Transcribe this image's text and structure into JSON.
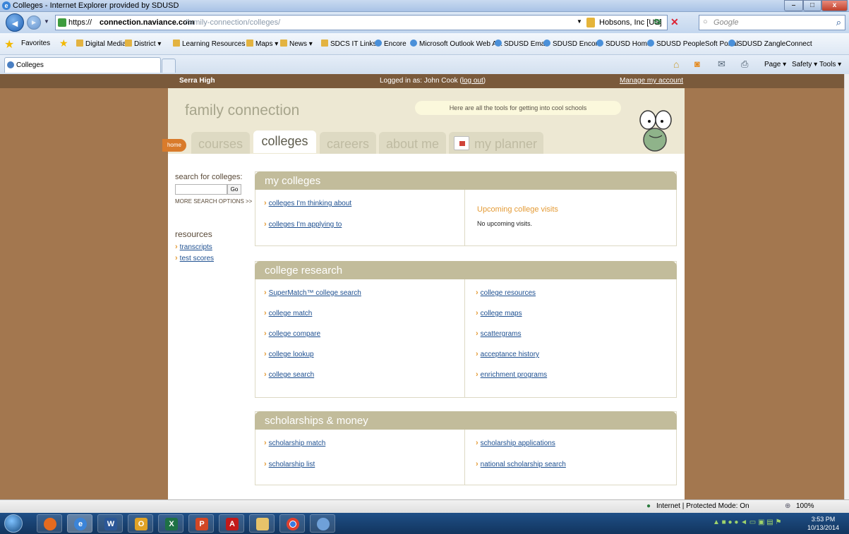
{
  "window": {
    "title": "Colleges - Internet Explorer provided by SDUSD",
    "minimize": "–",
    "maximize": "□",
    "close": "x"
  },
  "address": {
    "url_scheme": "https://",
    "url_domain": "connection.naviance.com",
    "url_path": "/family-connection/colleges/",
    "cert_owner": "Hobsons, Inc [US]",
    "search_placeholder": "Google"
  },
  "favorites": {
    "label": "Favorites",
    "items": [
      "Digital Media ▾",
      "District ▾",
      "Learning Resources ▾",
      "Maps ▾",
      "News ▾",
      "SDCS IT Links ▾",
      "Encore",
      "Microsoft Outlook Web A...",
      "SDUSD Email",
      "SDUSD Encore",
      "SDUSD Home",
      "SDUSD PeopleSoft Portal",
      "SDUSD ZangleConnect"
    ]
  },
  "browser_tab": {
    "label": "Colleges"
  },
  "command_bar": {
    "page": "Page ▾",
    "safety": "Safety ▾",
    "tools": "Tools ▾"
  },
  "site_topbar": {
    "school": "Serra High",
    "login_text": "Logged in as: John Cook (",
    "logout": "log out",
    "login_close": ")",
    "manage": "Manage my account"
  },
  "header": {
    "logo": "family connection",
    "bubble": "Here are all the tools for getting into cool schools",
    "home": "home",
    "tabs": [
      "courses",
      "colleges",
      "careers",
      "about me",
      "my planner"
    ]
  },
  "sidebar": {
    "search_label": "search for colleges:",
    "go": "Go",
    "more_search": "MORE SEARCH OPTIONS >>",
    "resources_title": "resources",
    "resources": [
      "transcripts",
      "test scores"
    ]
  },
  "my_colleges": {
    "title": "my colleges",
    "links": [
      "colleges I'm thinking about",
      "colleges I'm applying to"
    ],
    "visits_title": "Upcoming college visits",
    "visits_text": "No upcoming visits."
  },
  "college_research": {
    "title": "college research",
    "left": [
      "SuperMatch™ college search",
      "college match",
      "college compare",
      "college lookup",
      "college search"
    ],
    "right": [
      "college resources",
      "college maps",
      "scattergrams",
      "acceptance history",
      "enrichment programs"
    ]
  },
  "scholarships": {
    "title": "scholarships & money",
    "left": [
      "scholarship match",
      "scholarship list"
    ],
    "right": [
      "scholarship applications",
      "national scholarship search"
    ]
  },
  "status": {
    "zone": "Internet | Protected Mode: On",
    "zoom": "100%"
  },
  "clock": {
    "time": "3:53 PM",
    "date": "10/13/2014"
  },
  "colors": {
    "accent": "#e49b36",
    "link": "#1d4f90",
    "panel_header": "#c2bc9b",
    "page_bg": "#a3774f"
  }
}
